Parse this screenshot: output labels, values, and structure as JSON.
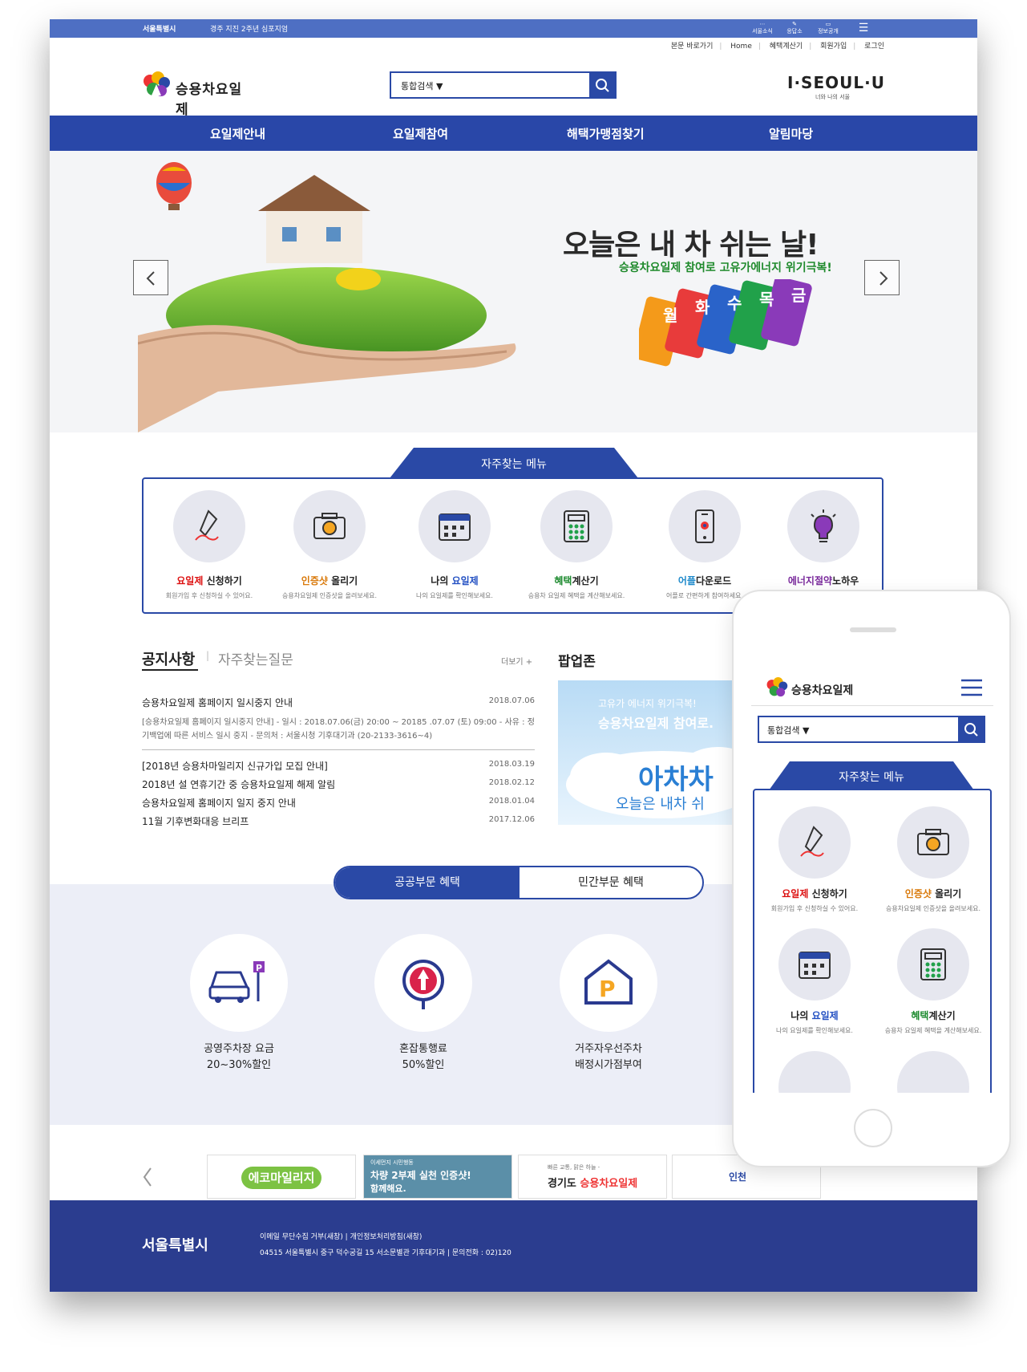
{
  "topbar": {
    "city": "서울특별시",
    "notice": "경주 지진 2주년 심포지엄",
    "icons": [
      "서울소식",
      "응답소",
      "정보공개"
    ]
  },
  "util_links": [
    "본문 바로가기",
    "Home",
    "혜택계산기",
    "회원가입",
    "로그인"
  ],
  "logo_text": "승용차요일제",
  "search": {
    "select": "통합검색"
  },
  "brand": {
    "main": "I·SEOUL·U",
    "sub": "너와 나의 서울"
  },
  "gnb": [
    "요일제안내",
    "요일제참여",
    "해택가맹점찾기",
    "알림마당"
  ],
  "hero": {
    "title": "오늘은 내 차 쉬는 날!",
    "subtitle": "승용차요일제 참여로 고유가에너지 위기극복!",
    "days": [
      "월",
      "화",
      "수",
      "목",
      "금"
    ]
  },
  "quick_menu": {
    "title": "자주찾는 메뉴",
    "items": [
      {
        "accent": "요일제",
        "rest": " 신청하기",
        "desc": "회원가입 후 신청하실 수 있어요.",
        "accent_color": "red",
        "accent_first": true
      },
      {
        "accent": "인증샷",
        "rest": " 올리기",
        "desc": "승용차요일제 인증샷을 올려보세요.",
        "accent_color": "orange",
        "accent_first": true
      },
      {
        "accent": "요일제",
        "rest": "나의 ",
        "desc": "나의 요일제를 확인해보세요.",
        "accent_color": "blue",
        "accent_first": false
      },
      {
        "accent": "혜택",
        "rest": "계산기",
        "desc": "승용차 요일제 혜택을 계산해보세요.",
        "accent_color": "green",
        "accent_first": true
      },
      {
        "accent": "어플",
        "rest": "다운로드",
        "desc": "어플로 간편하게 참여하세요.",
        "accent_color": "sky",
        "accent_first": true
      },
      {
        "accent": "에너지절약",
        "rest": "노하우",
        "desc": "",
        "accent_color": "purple",
        "accent_first": true
      }
    ]
  },
  "news": {
    "tab_active": "공지사항",
    "tab_other": "자주찾는질문",
    "more": "더보기 +",
    "first": {
      "title": "승용차요일제 홈페이지 일시중지 안내",
      "date": "2018.07.06",
      "summary": "[승용차요일제 홈페이지 일시중지 안내] - 일시 : 2018.07.06(금) 20:00 ~ 20185 .07.07 (토) 09:00 - 사유 : 정기백업에 따른 서비스 일시 중지 - 문의처 : 서울시청 기후대기과 (20-2133-3616~4)"
    },
    "items": [
      {
        "title": "[2018년 승용차마일리지 신규가입 모집 안내]",
        "date": "2018.03.19"
      },
      {
        "title": "2018년 설 연휴기간 중 승용차요일제 해제 알림",
        "date": "2018.02.12"
      },
      {
        "title": "승용차요일제 홈페이지 일지 중지 안내",
        "date": "2018.01.04"
      },
      {
        "title": "11월 기후변화대응 브리프",
        "date": "2017.12.06"
      }
    ]
  },
  "popup": {
    "title": "팝업존",
    "line1": "고유가 에너지 위기극복!",
    "line2": "승용차요일제 참여로.",
    "big": "아차차",
    "line3": "오늘은 내차 쉬"
  },
  "benefit": {
    "tab_active": "공공부문 혜택",
    "tab_other": "민간부문 혜택",
    "items": [
      {
        "line1": "공영주차장 요금",
        "line2": "20~30%할인"
      },
      {
        "line1": "혼잡통행료",
        "line2": "50%할인"
      },
      {
        "line1": "거주자우선주차",
        "line2": "배정시가점부여"
      }
    ]
  },
  "banners": [
    {
      "text": "에코마일리지"
    },
    {
      "text_small": "이세먼지 시민행동",
      "text": "차량 2부제 실천 인증샷!",
      "text2": "함께해요."
    },
    {
      "text_small": "빠른 교통, 맑은 하늘 -",
      "prefix": "경기도 ",
      "text": "승용차요일제"
    },
    {
      "text": "인천"
    }
  ],
  "footer": {
    "logo": "서울특별시",
    "links": "이메일 무단수집 거부(새창)   |   개인정보처리방침(새창)",
    "address": "04515 서울특별시 중구 덕수궁길 15 서소문별관 기후대기과   |   문의전화 : 02)120"
  },
  "mobile": {
    "logo_text": "승용차요일제",
    "search": "통합검색",
    "quick_title": "자주찾는 메뉴"
  },
  "colors": {
    "primary": "#2a49a6",
    "topbar": "#4e6fc3",
    "footer": "#2b3d8f"
  }
}
